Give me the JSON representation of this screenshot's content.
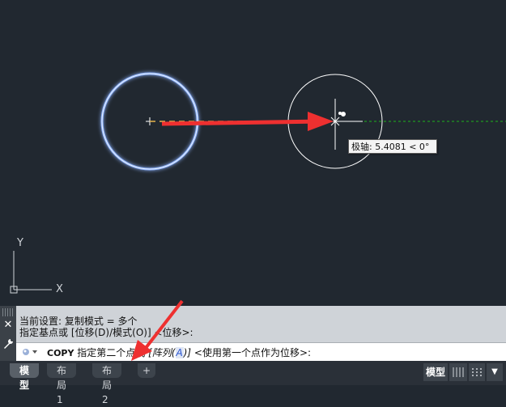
{
  "drawing": {
    "tooltip_text": "极轴: 5.4081 < 0°",
    "ucs": {
      "x_label": "X",
      "y_label": "Y"
    },
    "colors": {
      "background": "#212830",
      "circle_glow": "#8fb4ff",
      "circle": "#ffffff",
      "annotation_arrow": "#ee3030",
      "tracking_line": "#1db31d",
      "base_point_line": "#e6b34a"
    }
  },
  "command_line": {
    "history": [
      "当前设置:   复制模式 = 多个",
      "指定基点或 [位移(D)/模式(O)] <位移>:"
    ],
    "input": {
      "command": "COPY",
      "prompt": "指定第二个点或",
      "options_prefix": "[阵列(",
      "option_key": "A",
      "options_suffix": ")]",
      "default": "<使用第一个点作为位移>:"
    },
    "side_buttons": {
      "close": "✕",
      "customize": "🔧"
    }
  },
  "status_bar": {
    "tabs": [
      {
        "label": "模型",
        "active": true
      },
      {
        "label": "布局1",
        "active": false
      },
      {
        "label": "布局2",
        "active": false
      }
    ],
    "add_tab": "+",
    "model_button": "模型"
  }
}
